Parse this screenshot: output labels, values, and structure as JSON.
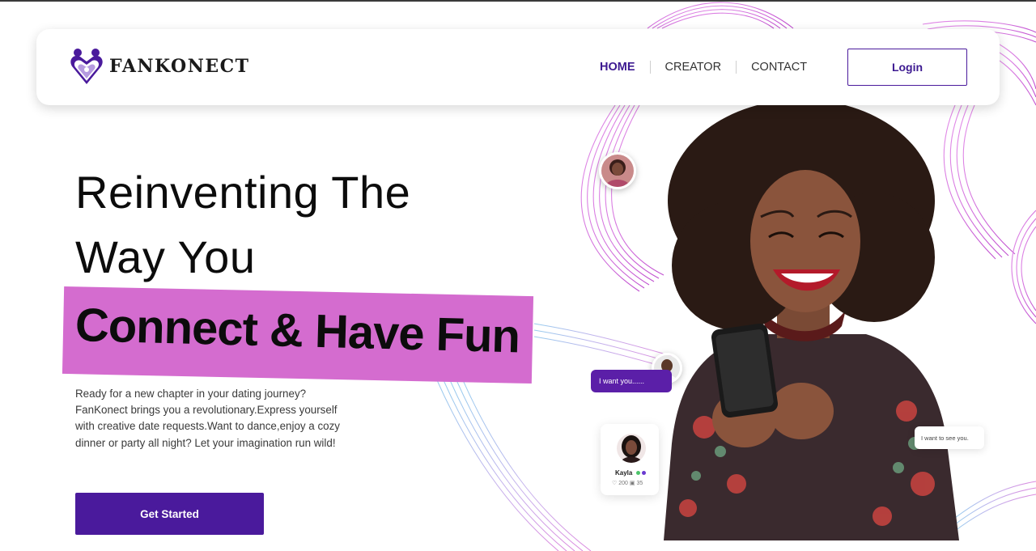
{
  "brand": {
    "name": "FANKONECT"
  },
  "nav": {
    "items": [
      {
        "label": "HOME",
        "active": true
      },
      {
        "label": "CREATOR",
        "active": false
      },
      {
        "label": "CONTACT",
        "active": false
      }
    ],
    "login_label": "Login"
  },
  "hero": {
    "line1": "Reinventing The",
    "line2": "Way You",
    "highlight": "Connect & Have Fun",
    "description": "Ready for a new chapter in your dating journey? FanKonect brings you a revolutionary.Express yourself with creative date requests.Want to dance,enjoy a cozy dinner or party all night? Let your imagination run wild!",
    "cta_label": "Get Started"
  },
  "chat": {
    "bubble_left": "I want you......",
    "bubble_right": "I want to see you."
  },
  "profile_card": {
    "name": "Kayla",
    "likes": "200",
    "posts": "35"
  },
  "colors": {
    "primary": "#4a1a9c",
    "highlight": "#d46ccf",
    "wave_pink": "#c940c9",
    "wave_blue": "#6fb0e0"
  }
}
